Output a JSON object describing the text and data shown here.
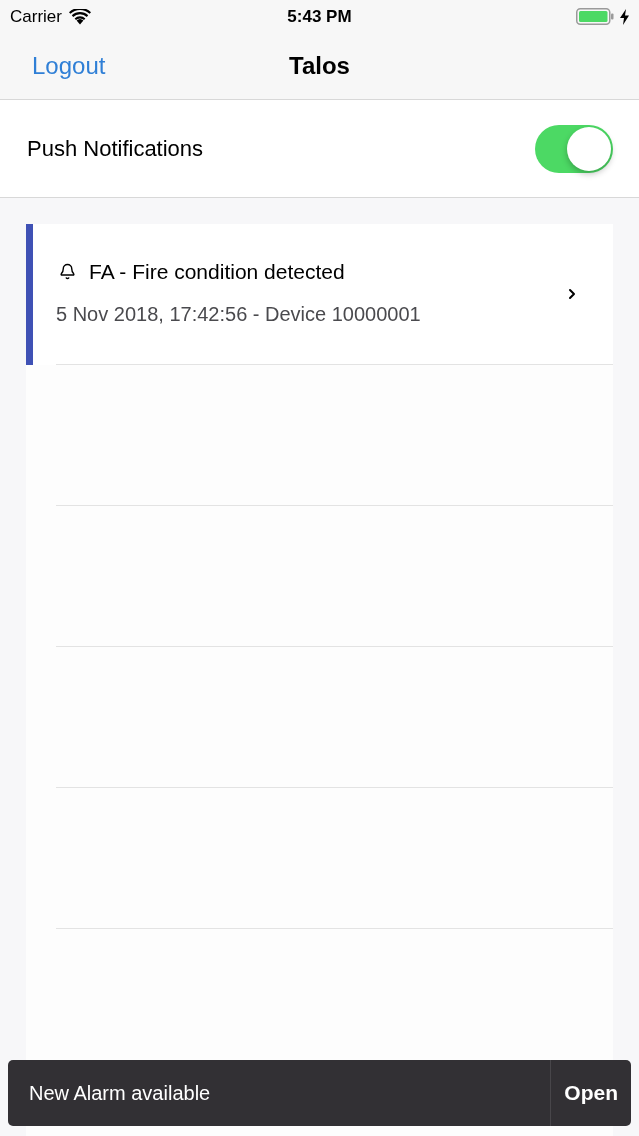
{
  "status_bar": {
    "carrier": "Carrier",
    "time": "5:43 PM"
  },
  "nav_bar": {
    "left_button": "Logout",
    "title": "Talos"
  },
  "push_notifications": {
    "label": "Push Notifications",
    "on": true
  },
  "alarms": [
    {
      "title": "FA - Fire condition detected",
      "subtitle": "5 Nov 2018, 17:42:56 - Device 10000001",
      "color": "#3f51b5"
    }
  ],
  "snackbar": {
    "message": "New Alarm available",
    "action": "Open"
  }
}
